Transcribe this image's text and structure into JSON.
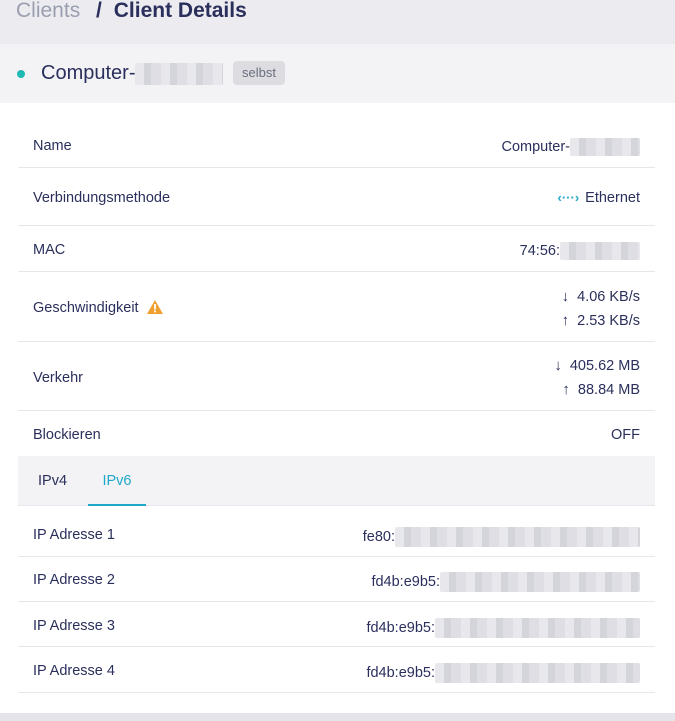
{
  "breadcrumb": {
    "parent": "Clients",
    "separator": "/",
    "current": "Client Details"
  },
  "header": {
    "device_name": "Computer-",
    "badge": "selbst"
  },
  "details": {
    "name": {
      "label": "Name",
      "value": "Computer-"
    },
    "connection": {
      "label": "Verbindungsmethode",
      "icon": "ethernet-icon",
      "value": "Ethernet"
    },
    "mac": {
      "label": "MAC",
      "value": "74:56:"
    },
    "speed": {
      "label": "Geschwindigkeit",
      "icon": "warning-icon",
      "down": "4.06 KB/s",
      "up": "2.53 KB/s"
    },
    "traffic": {
      "label": "Verkehr",
      "down": "405.62 MB",
      "up": "88.84 MB"
    },
    "block": {
      "label": "Blockieren",
      "value": "OFF"
    }
  },
  "tabs": [
    {
      "label": "IPv4",
      "active": false
    },
    {
      "label": "IPv6",
      "active": true
    }
  ],
  "ip_addresses": [
    {
      "label": "IP Adresse 1",
      "value": "fe80:"
    },
    {
      "label": "IP Adresse 2",
      "value": "fd4b:e9b5:"
    },
    {
      "label": "IP Adresse 3",
      "value": "fd4b:e9b5:"
    },
    {
      "label": "IP Adresse 4",
      "value": "fd4b:e9b5:"
    }
  ],
  "colors": {
    "accent": "#1fa8c9",
    "status_online": "#1fb8b2",
    "warning": "#f0a030",
    "text": "#2a2f5b"
  }
}
